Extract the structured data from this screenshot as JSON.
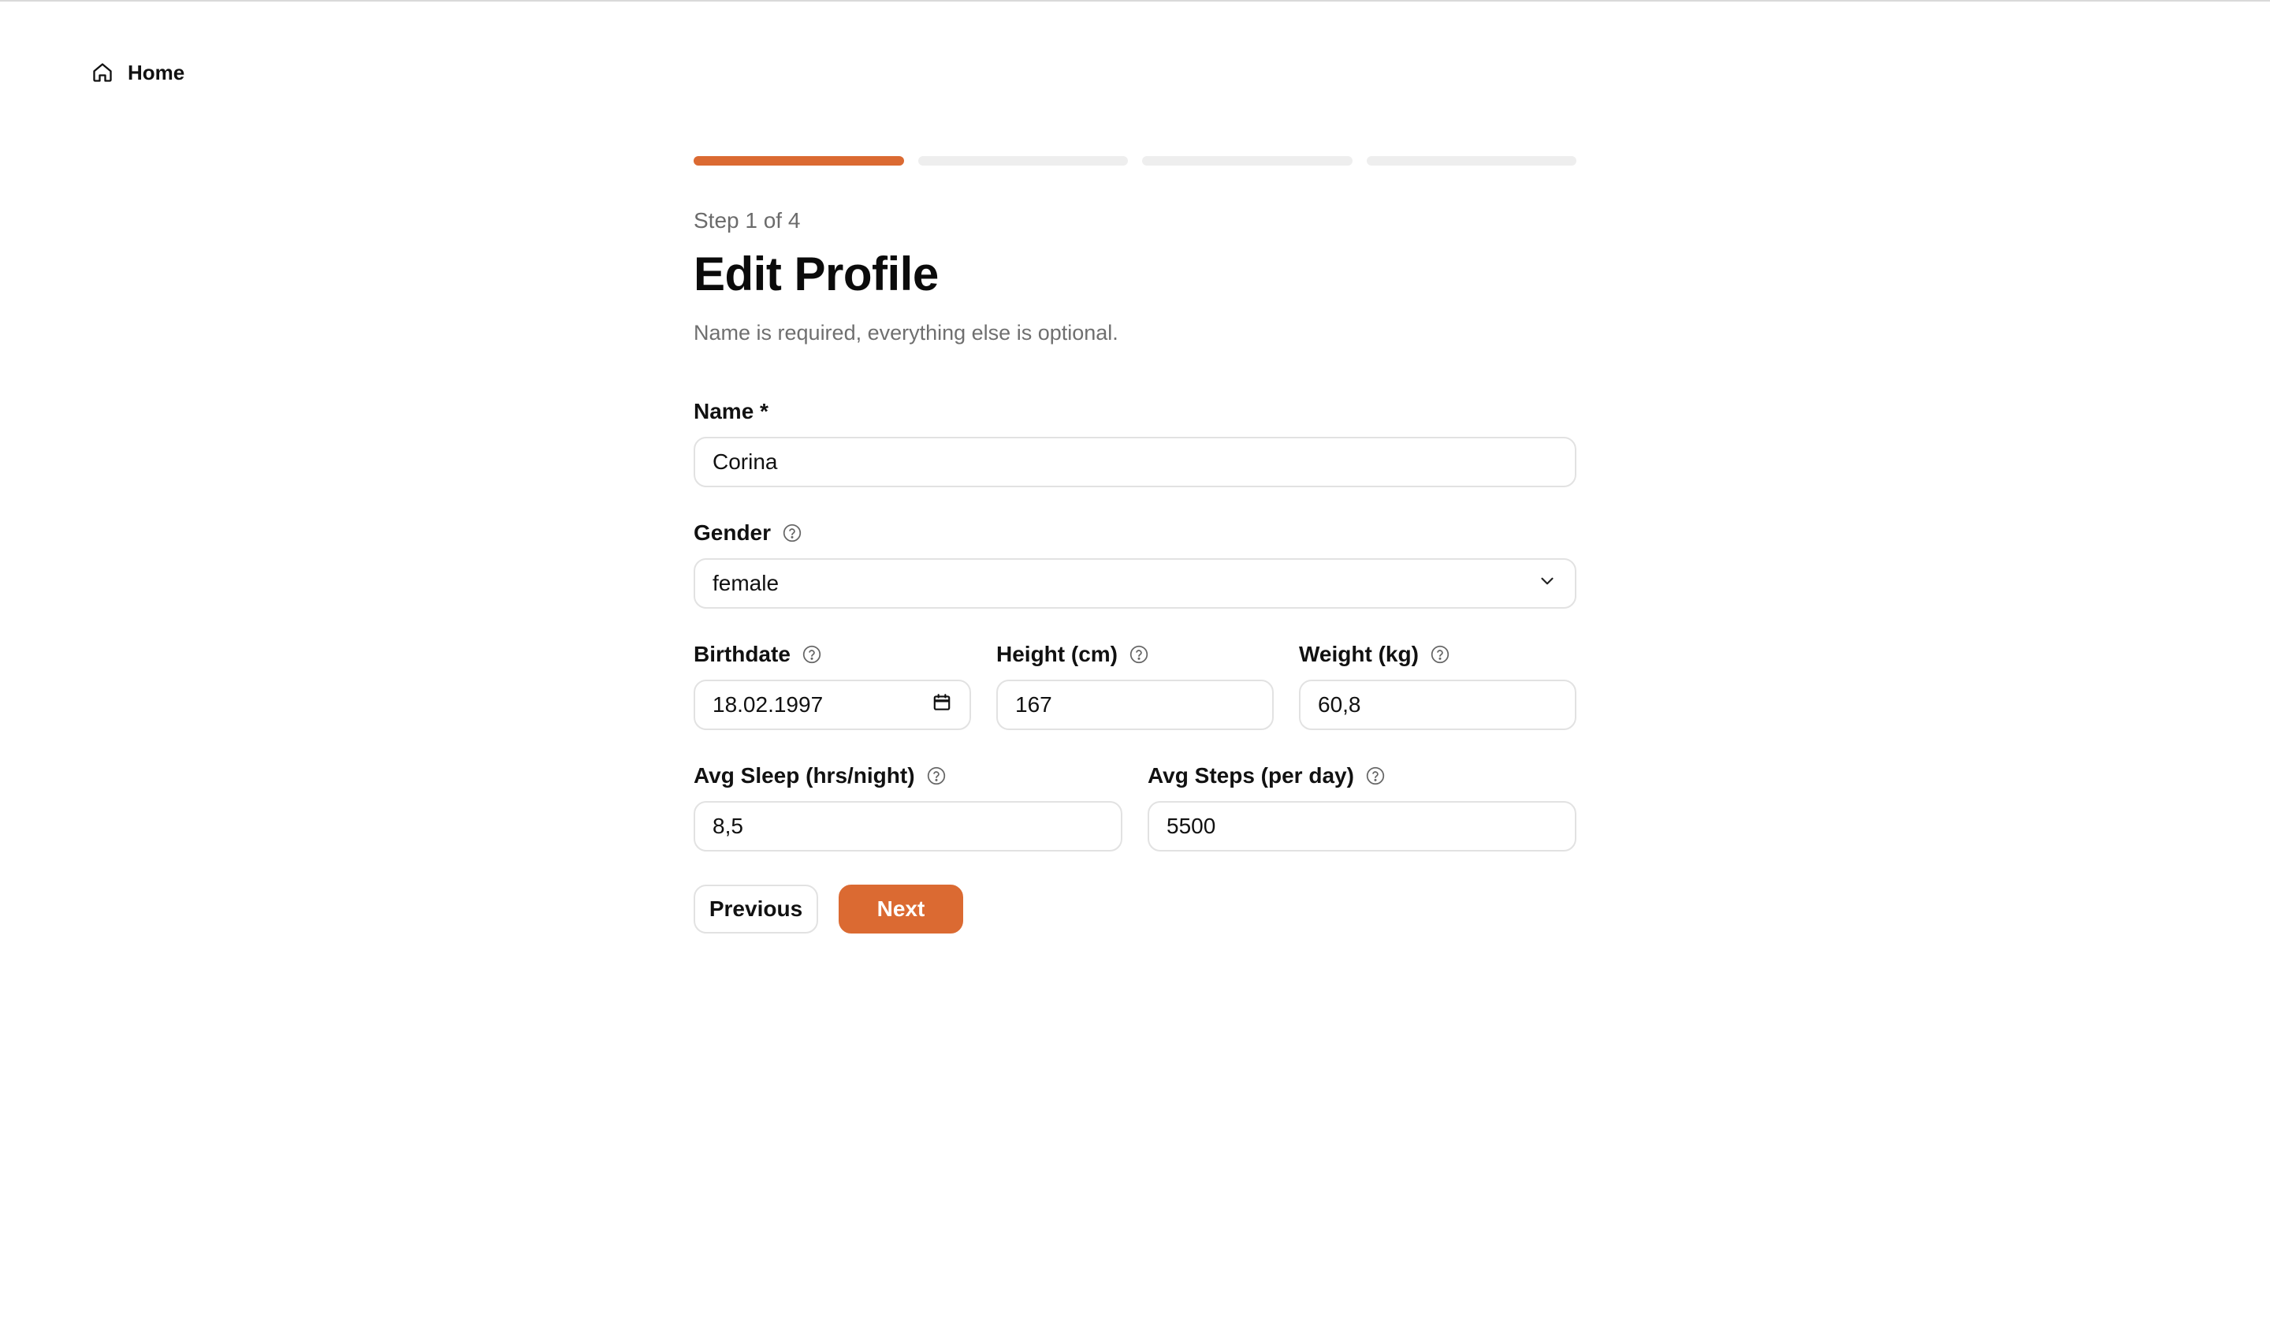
{
  "nav": {
    "home_label": "Home",
    "home_icon": "home-icon"
  },
  "wizard": {
    "progress": {
      "total_steps": 4,
      "current_step": 1,
      "active_color": "#db6a32",
      "inactive_color": "#eeeeee"
    },
    "step_label": "Step 1 of 4",
    "title": "Edit Profile",
    "subtitle": "Name is required, everything else is optional."
  },
  "form": {
    "name": {
      "label": "Name *",
      "value": "Corina"
    },
    "gender": {
      "label": "Gender",
      "value": "female",
      "help_icon": "help-circle-icon"
    },
    "birthdate": {
      "label": "Birthdate",
      "value": "18.02.1997",
      "help_icon": "help-circle-icon",
      "picker_icon": "calendar-icon"
    },
    "height": {
      "label": "Height (cm)",
      "value": "167",
      "help_icon": "help-circle-icon"
    },
    "weight": {
      "label": "Weight (kg)",
      "value": "60,8",
      "help_icon": "help-circle-icon"
    },
    "sleep": {
      "label": "Avg Sleep (hrs/night)",
      "value": "8,5",
      "help_icon": "help-circle-icon"
    },
    "steps": {
      "label": "Avg Steps (per day)",
      "value": "5500",
      "help_icon": "help-circle-icon"
    }
  },
  "actions": {
    "previous_label": "Previous",
    "next_label": "Next",
    "accent_color": "#db6a32"
  }
}
